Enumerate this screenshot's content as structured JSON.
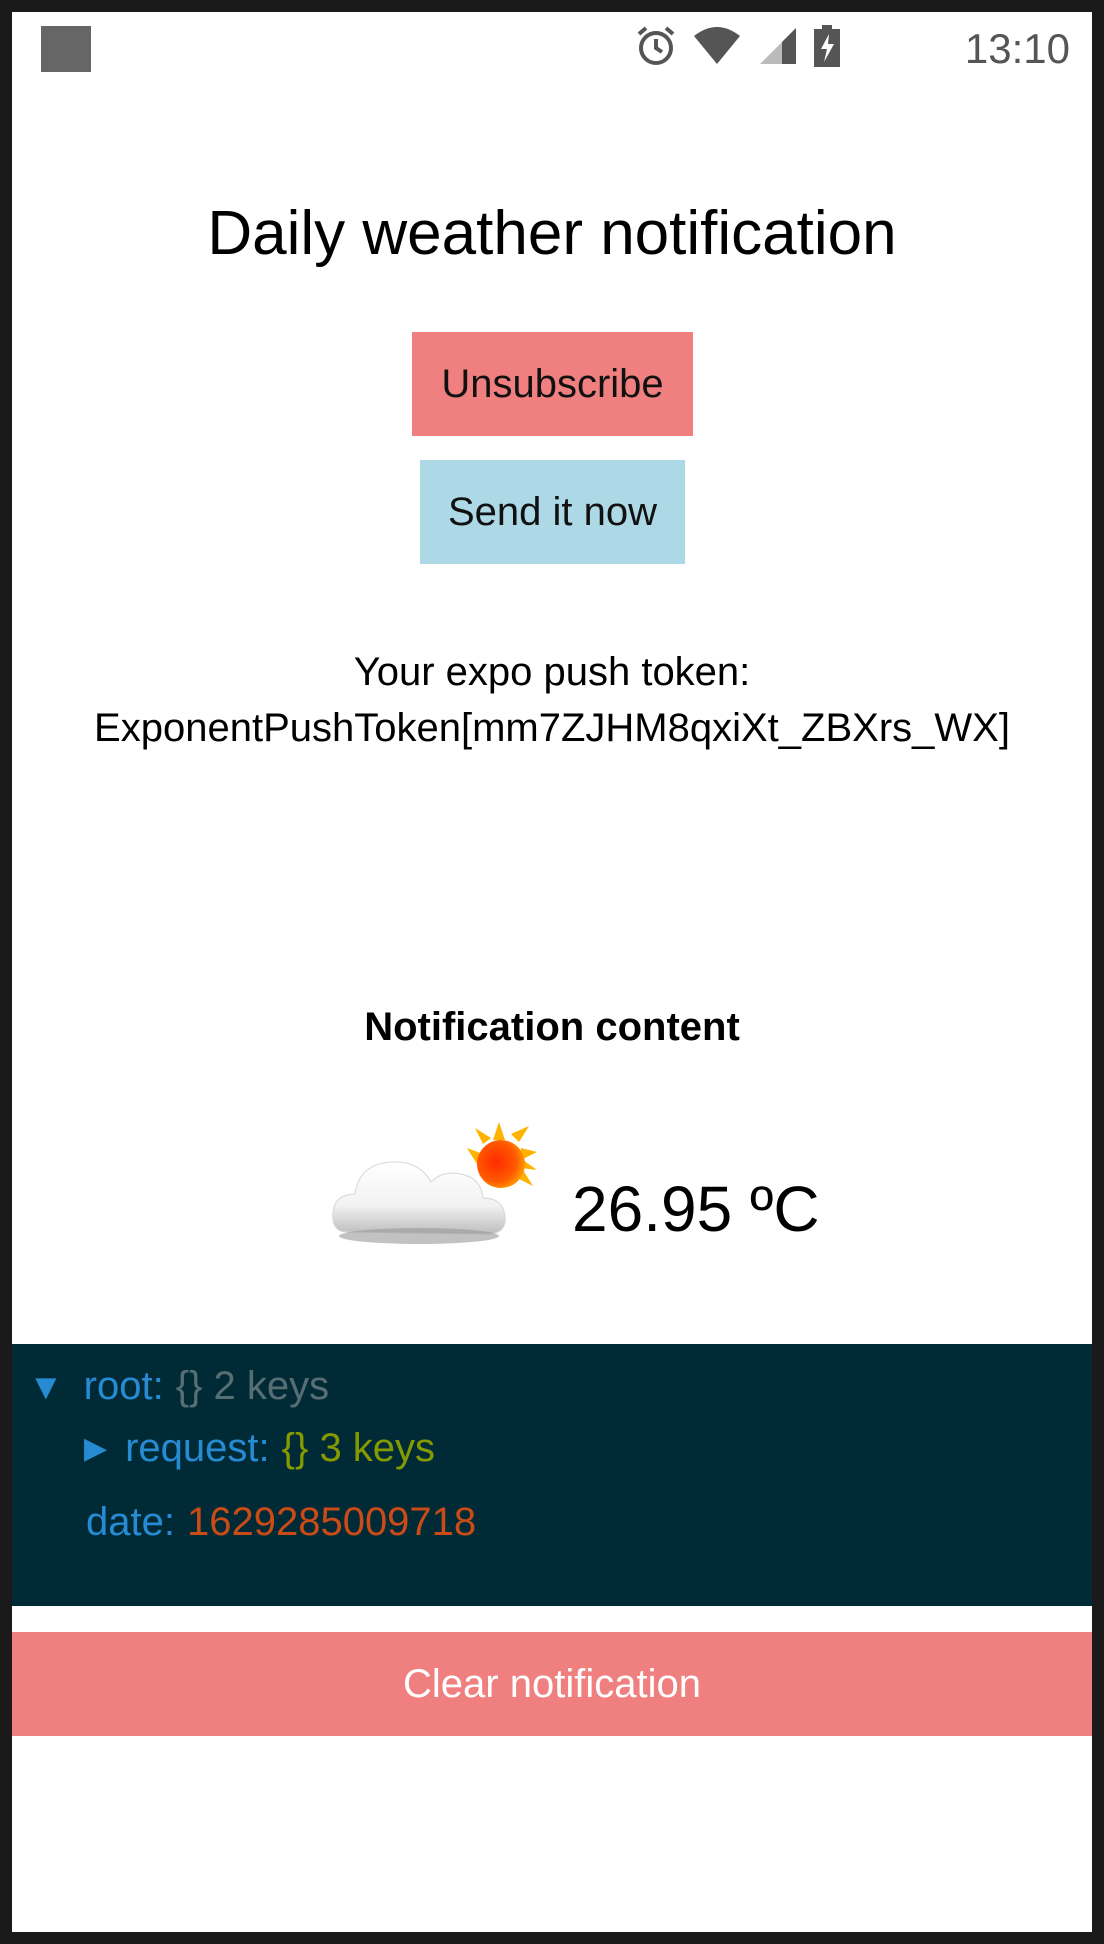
{
  "status_bar": {
    "time": "13:10",
    "icons": [
      "alarm-icon",
      "wifi-icon",
      "cellular-signal-icon",
      "battery-charging-icon"
    ]
  },
  "main": {
    "title": "Daily weather notification",
    "unsubscribe_label": "Unsubscribe",
    "send_now_label": "Send it now",
    "token_label": "Your expo push token:",
    "token_value": "ExponentPushToken[mm7ZJHM8qxiXt_ZBXrs_WX]"
  },
  "notification": {
    "heading": "Notification content",
    "weather_icon": "partly-cloudy-icon",
    "temperature": "26.95 ºC"
  },
  "json_viewer": {
    "root_key": "root:",
    "root_meta": "{} 2 keys",
    "request_key": "request:",
    "request_meta": "{} 3 keys",
    "date_key": "date:",
    "date_value": "1629285009718"
  },
  "actions": {
    "clear_label": "Clear notification"
  },
  "colors": {
    "unsubscribe_bg": "#f08080",
    "send_now_bg": "#add8e6",
    "json_bg": "#002b36",
    "json_key": "#268bd2",
    "json_number": "#cb4b16",
    "clear_bg": "#f08080"
  }
}
